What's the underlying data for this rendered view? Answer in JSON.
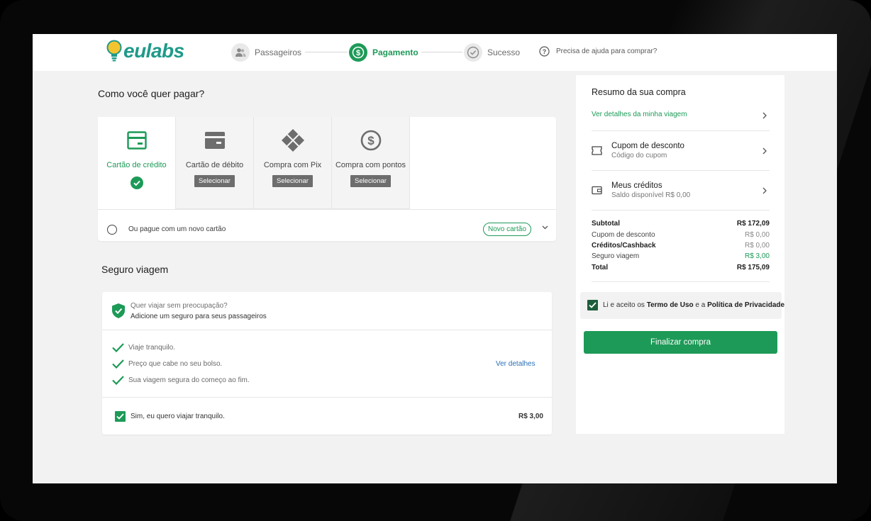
{
  "brand": {
    "name": "eulabs"
  },
  "steps": [
    {
      "label": "Passageiros",
      "icon": "users-icon"
    },
    {
      "label": "Pagamento",
      "icon": "dollar-icon",
      "active": true
    },
    {
      "label": "Sucesso",
      "icon": "check-circle-icon"
    }
  ],
  "help": {
    "label": "Precisa de ajuda para comprar?"
  },
  "payment": {
    "heading": "Como você quer pagar?",
    "options": [
      {
        "label": "Cartão de crédito",
        "selected": true,
        "icon": "credit-card-icon"
      },
      {
        "label": "Cartão de débito",
        "button": "Selecionar",
        "icon": "debit-card-icon"
      },
      {
        "label": "Compra com Pix",
        "button": "Selecionar",
        "icon": "pix-icon"
      },
      {
        "label": "Compra com pontos",
        "button": "Selecionar",
        "icon": "coin-icon"
      }
    ],
    "new_card_text": "Ou pague com um novo cartão",
    "new_card_pill": "Novo cartão"
  },
  "insurance": {
    "heading": "Seguro viagem",
    "question": "Quer viajar sem preocupação?",
    "subtitle": "Adicione um seguro para seus passageiros",
    "benefits": [
      "Viaje tranquilo.",
      "Preço que cabe no seu bolso.",
      "Sua viagem segura do começo ao fim."
    ],
    "details_link": "Ver detalhes",
    "accept_text": "Sim, eu quero viajar tranquilo.",
    "price": "R$ 3,00",
    "accepted": true
  },
  "summary": {
    "title": "Resumo da sua compra",
    "details_link": "Ver detalhes da minha viagem",
    "coupon": {
      "title": "Cupom de desconto",
      "subtitle": "Código do cupom"
    },
    "credits": {
      "title": "Meus créditos",
      "subtitle": "Saldo disponível R$ 0,00"
    },
    "totals": [
      {
        "label": "Subtotal",
        "value": "R$ 172,09"
      },
      {
        "label": "Cupom de desconto",
        "value": "R$ 0,00"
      },
      {
        "label": "Créditos/Cashback",
        "value": "R$ 0,00"
      },
      {
        "label": "Seguro viagem",
        "value": "R$ 3,00"
      },
      {
        "label": "Total",
        "value": "R$ 175,09"
      }
    ],
    "terms": {
      "prefix": "Li e aceito os ",
      "terms_link": "Termo de Uso",
      "middle": " e a ",
      "privacy_link": "Política de Privacidade",
      "accepted": true
    },
    "finalize_label": "Finalizar compra"
  },
  "colors": {
    "primary": "#1d9a57",
    "link": "#2a6fb5",
    "logo": "#1f9a8a",
    "bulb": "#f4c430"
  }
}
